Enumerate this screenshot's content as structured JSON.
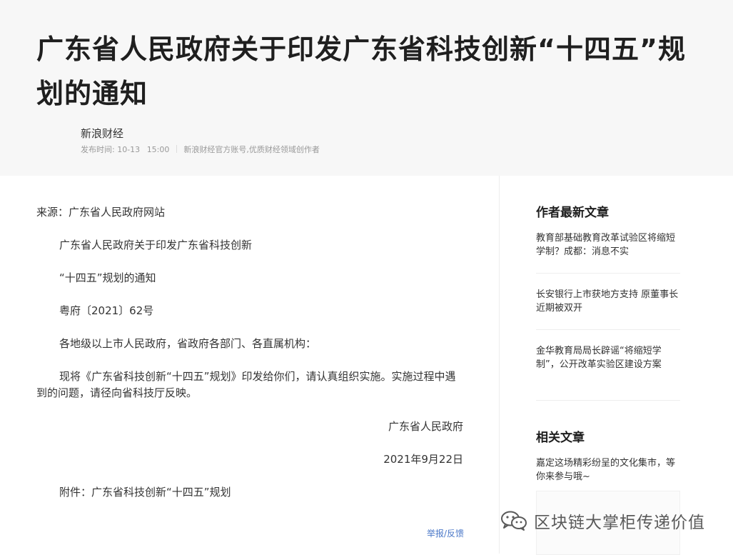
{
  "article": {
    "title": "广东省人民政府关于印发广东省科技创新“十四五”规划的通知",
    "author": "新浪财经",
    "publish_label": "发布时间:",
    "publish_date": "10-13",
    "publish_time": "15:00",
    "author_desc": "新浪财经官方账号,优质财经领域创作者",
    "paragraphs": [
      "来源：广东省人民政府网站",
      "广东省人民政府关于印发广东省科技创新",
      "“十四五”规划的通知",
      "粤府〔2021〕62号",
      "各地级以上市人民政府，省政府各部门、各直属机构：",
      "现将《广东省科技创新“十四五”规划》印发给你们，请认真组织实施。实施过程中遇到的问题，请径向省科技厅反映。",
      "广东省人民政府",
      "2021年9月22日",
      "附件：广东省科技创新“十四五”规划"
    ],
    "report_link": "举报/反馈"
  },
  "sidebar": {
    "latest_heading": "作者最新文章",
    "latest_items": [
      "教育部基础教育改革试验区将缩短学制？成都：消息不实",
      "长安银行上市获地方支持 原董事长近期被双开",
      "金华教育局局长辟谣“将缩短学制”，公开改革实验区建设方案"
    ],
    "related_heading": "相关文章",
    "related_items": [
      "嘉定这场精彩纷呈的文化集市，等你来参与哦~"
    ]
  },
  "watermark": {
    "text": "区块链大掌柜传递价值",
    "icon": "wechat-icon"
  }
}
